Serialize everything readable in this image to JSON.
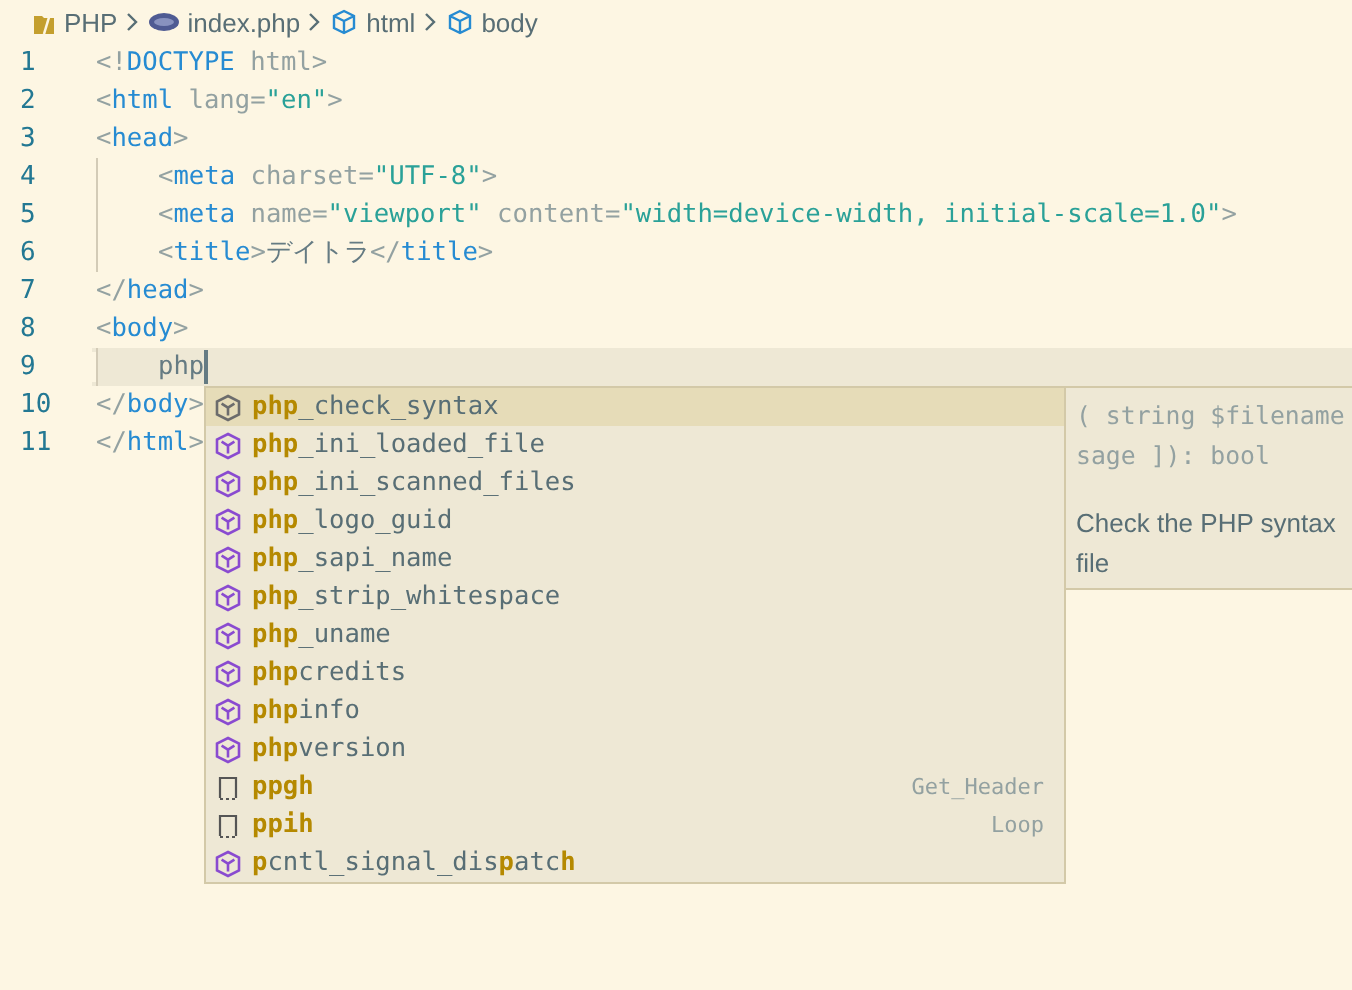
{
  "breadcrumbs": [
    {
      "kind": "folder",
      "label": "PHP"
    },
    {
      "kind": "php-file",
      "label": "index.php"
    },
    {
      "kind": "element",
      "label": "html"
    },
    {
      "kind": "element",
      "label": "body"
    }
  ],
  "lines": [
    {
      "number": "1",
      "current": false,
      "tokens": [
        {
          "kind": "bracket",
          "text": "<!"
        },
        {
          "kind": "tag",
          "text": "DOCTYPE"
        },
        {
          "kind": "attr",
          "text": " html"
        },
        {
          "kind": "bracket",
          "text": ">"
        }
      ]
    },
    {
      "number": "2",
      "current": false,
      "tokens": [
        {
          "kind": "bracket",
          "text": "<"
        },
        {
          "kind": "tag",
          "text": "html"
        },
        {
          "kind": "attr",
          "text": " lang"
        },
        {
          "kind": "bracket",
          "text": "="
        },
        {
          "kind": "string",
          "text": "\"en\""
        },
        {
          "kind": "bracket",
          "text": ">"
        }
      ]
    },
    {
      "number": "3",
      "current": false,
      "tokens": [
        {
          "kind": "bracket",
          "text": "<"
        },
        {
          "kind": "tag",
          "text": "head"
        },
        {
          "kind": "bracket",
          "text": ">"
        }
      ]
    },
    {
      "number": "4",
      "current": false,
      "indent": true,
      "tokens": [
        {
          "kind": "bracket",
          "text": "<"
        },
        {
          "kind": "tag",
          "text": "meta"
        },
        {
          "kind": "attr",
          "text": " charset"
        },
        {
          "kind": "bracket",
          "text": "="
        },
        {
          "kind": "string",
          "text": "\"UTF-8\""
        },
        {
          "kind": "bracket",
          "text": ">"
        }
      ]
    },
    {
      "number": "5",
      "current": false,
      "indent": true,
      "tokens": [
        {
          "kind": "bracket",
          "text": "<"
        },
        {
          "kind": "tag",
          "text": "meta"
        },
        {
          "kind": "attr",
          "text": " name"
        },
        {
          "kind": "bracket",
          "text": "="
        },
        {
          "kind": "string",
          "text": "\"viewport\""
        },
        {
          "kind": "attr",
          "text": " content"
        },
        {
          "kind": "bracket",
          "text": "="
        },
        {
          "kind": "string",
          "text": "\"width=device-width, initial-scale=1.0\""
        },
        {
          "kind": "bracket",
          "text": ">"
        }
      ]
    },
    {
      "number": "6",
      "current": false,
      "indent": true,
      "tokens": [
        {
          "kind": "bracket",
          "text": "<"
        },
        {
          "kind": "tag",
          "text": "title"
        },
        {
          "kind": "bracket",
          "text": ">"
        },
        {
          "kind": "text",
          "text": "デイトラ"
        },
        {
          "kind": "bracket",
          "text": "</"
        },
        {
          "kind": "tag",
          "text": "title"
        },
        {
          "kind": "bracket",
          "text": ">"
        }
      ]
    },
    {
      "number": "7",
      "current": false,
      "tokens": [
        {
          "kind": "bracket",
          "text": "</"
        },
        {
          "kind": "tag",
          "text": "head"
        },
        {
          "kind": "bracket",
          "text": ">"
        }
      ]
    },
    {
      "number": "8",
      "current": false,
      "tokens": [
        {
          "kind": "bracket",
          "text": "<"
        },
        {
          "kind": "tag",
          "text": "body"
        },
        {
          "kind": "bracket",
          "text": ">"
        }
      ]
    },
    {
      "number": "9",
      "current": true,
      "indent": true,
      "tokens": [
        {
          "kind": "text",
          "text": "php"
        }
      ]
    },
    {
      "number": "10",
      "current": false,
      "tokens": [
        {
          "kind": "bracket",
          "text": "</"
        },
        {
          "kind": "tag",
          "text": "body"
        },
        {
          "kind": "bracket",
          "text": ">"
        }
      ]
    },
    {
      "number": "11",
      "current": false,
      "tokens": [
        {
          "kind": "bracket",
          "text": "</"
        },
        {
          "kind": "tag",
          "text": "html"
        },
        {
          "kind": "bracket",
          "text": ">"
        }
      ]
    }
  ],
  "suggestions": [
    {
      "kind": "function",
      "label": "**php**_check_syntax",
      "selected": true
    },
    {
      "kind": "function",
      "label": "**php**_ini_loaded_file",
      "selected": false
    },
    {
      "kind": "function",
      "label": "**php**_ini_scanned_files",
      "selected": false
    },
    {
      "kind": "function",
      "label": "**php**_logo_guid",
      "selected": false
    },
    {
      "kind": "function",
      "label": "**php**_sapi_name",
      "selected": false
    },
    {
      "kind": "function",
      "label": "**php**_strip_whitespace",
      "selected": false
    },
    {
      "kind": "function",
      "label": "**php**_uname",
      "selected": false
    },
    {
      "kind": "function",
      "label": "**php**credits",
      "selected": false
    },
    {
      "kind": "function",
      "label": "**php**info",
      "selected": false
    },
    {
      "kind": "function",
      "label": "**php**version",
      "selected": false
    },
    {
      "kind": "snippet",
      "label": "**ppgh**",
      "detail": "Get_Header",
      "selected": false
    },
    {
      "kind": "snippet",
      "label": "**ppih**",
      "detail": "Loop",
      "selected": false
    },
    {
      "kind": "function",
      "label": "**p**cntl_signal_dis**p**atc**h**",
      "selected": false
    }
  ],
  "details": {
    "signature": [
      "( string $filename",
      "sage ]): bool"
    ],
    "description": [
      "Check the PHP syntax",
      "file"
    ]
  }
}
